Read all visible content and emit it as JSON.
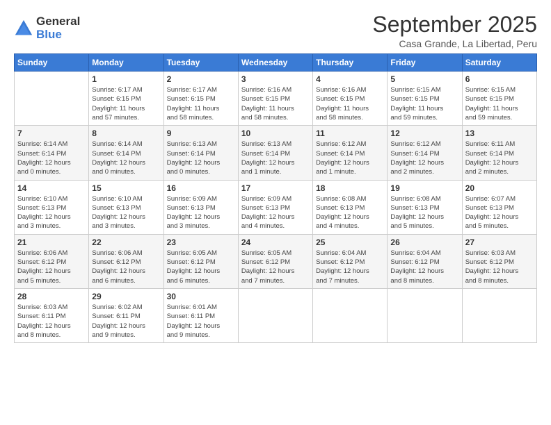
{
  "logo": {
    "general": "General",
    "blue": "Blue"
  },
  "title": "September 2025",
  "subtitle": "Casa Grande, La Libertad, Peru",
  "days_header": [
    "Sunday",
    "Monday",
    "Tuesday",
    "Wednesday",
    "Thursday",
    "Friday",
    "Saturday"
  ],
  "weeks": [
    [
      {
        "num": "",
        "info": ""
      },
      {
        "num": "1",
        "info": "Sunrise: 6:17 AM\nSunset: 6:15 PM\nDaylight: 11 hours\nand 57 minutes."
      },
      {
        "num": "2",
        "info": "Sunrise: 6:17 AM\nSunset: 6:15 PM\nDaylight: 11 hours\nand 58 minutes."
      },
      {
        "num": "3",
        "info": "Sunrise: 6:16 AM\nSunset: 6:15 PM\nDaylight: 11 hours\nand 58 minutes."
      },
      {
        "num": "4",
        "info": "Sunrise: 6:16 AM\nSunset: 6:15 PM\nDaylight: 11 hours\nand 58 minutes."
      },
      {
        "num": "5",
        "info": "Sunrise: 6:15 AM\nSunset: 6:15 PM\nDaylight: 11 hours\nand 59 minutes."
      },
      {
        "num": "6",
        "info": "Sunrise: 6:15 AM\nSunset: 6:15 PM\nDaylight: 11 hours\nand 59 minutes."
      }
    ],
    [
      {
        "num": "7",
        "info": "Sunrise: 6:14 AM\nSunset: 6:14 PM\nDaylight: 12 hours\nand 0 minutes."
      },
      {
        "num": "8",
        "info": "Sunrise: 6:14 AM\nSunset: 6:14 PM\nDaylight: 12 hours\nand 0 minutes."
      },
      {
        "num": "9",
        "info": "Sunrise: 6:13 AM\nSunset: 6:14 PM\nDaylight: 12 hours\nand 0 minutes."
      },
      {
        "num": "10",
        "info": "Sunrise: 6:13 AM\nSunset: 6:14 PM\nDaylight: 12 hours\nand 1 minute."
      },
      {
        "num": "11",
        "info": "Sunrise: 6:12 AM\nSunset: 6:14 PM\nDaylight: 12 hours\nand 1 minute."
      },
      {
        "num": "12",
        "info": "Sunrise: 6:12 AM\nSunset: 6:14 PM\nDaylight: 12 hours\nand 2 minutes."
      },
      {
        "num": "13",
        "info": "Sunrise: 6:11 AM\nSunset: 6:14 PM\nDaylight: 12 hours\nand 2 minutes."
      }
    ],
    [
      {
        "num": "14",
        "info": "Sunrise: 6:10 AM\nSunset: 6:13 PM\nDaylight: 12 hours\nand 3 minutes."
      },
      {
        "num": "15",
        "info": "Sunrise: 6:10 AM\nSunset: 6:13 PM\nDaylight: 12 hours\nand 3 minutes."
      },
      {
        "num": "16",
        "info": "Sunrise: 6:09 AM\nSunset: 6:13 PM\nDaylight: 12 hours\nand 3 minutes."
      },
      {
        "num": "17",
        "info": "Sunrise: 6:09 AM\nSunset: 6:13 PM\nDaylight: 12 hours\nand 4 minutes."
      },
      {
        "num": "18",
        "info": "Sunrise: 6:08 AM\nSunset: 6:13 PM\nDaylight: 12 hours\nand 4 minutes."
      },
      {
        "num": "19",
        "info": "Sunrise: 6:08 AM\nSunset: 6:13 PM\nDaylight: 12 hours\nand 5 minutes."
      },
      {
        "num": "20",
        "info": "Sunrise: 6:07 AM\nSunset: 6:13 PM\nDaylight: 12 hours\nand 5 minutes."
      }
    ],
    [
      {
        "num": "21",
        "info": "Sunrise: 6:06 AM\nSunset: 6:12 PM\nDaylight: 12 hours\nand 5 minutes."
      },
      {
        "num": "22",
        "info": "Sunrise: 6:06 AM\nSunset: 6:12 PM\nDaylight: 12 hours\nand 6 minutes."
      },
      {
        "num": "23",
        "info": "Sunrise: 6:05 AM\nSunset: 6:12 PM\nDaylight: 12 hours\nand 6 minutes."
      },
      {
        "num": "24",
        "info": "Sunrise: 6:05 AM\nSunset: 6:12 PM\nDaylight: 12 hours\nand 7 minutes."
      },
      {
        "num": "25",
        "info": "Sunrise: 6:04 AM\nSunset: 6:12 PM\nDaylight: 12 hours\nand 7 minutes."
      },
      {
        "num": "26",
        "info": "Sunrise: 6:04 AM\nSunset: 6:12 PM\nDaylight: 12 hours\nand 8 minutes."
      },
      {
        "num": "27",
        "info": "Sunrise: 6:03 AM\nSunset: 6:12 PM\nDaylight: 12 hours\nand 8 minutes."
      }
    ],
    [
      {
        "num": "28",
        "info": "Sunrise: 6:03 AM\nSunset: 6:11 PM\nDaylight: 12 hours\nand 8 minutes."
      },
      {
        "num": "29",
        "info": "Sunrise: 6:02 AM\nSunset: 6:11 PM\nDaylight: 12 hours\nand 9 minutes."
      },
      {
        "num": "30",
        "info": "Sunrise: 6:01 AM\nSunset: 6:11 PM\nDaylight: 12 hours\nand 9 minutes."
      },
      {
        "num": "",
        "info": ""
      },
      {
        "num": "",
        "info": ""
      },
      {
        "num": "",
        "info": ""
      },
      {
        "num": "",
        "info": ""
      }
    ]
  ]
}
